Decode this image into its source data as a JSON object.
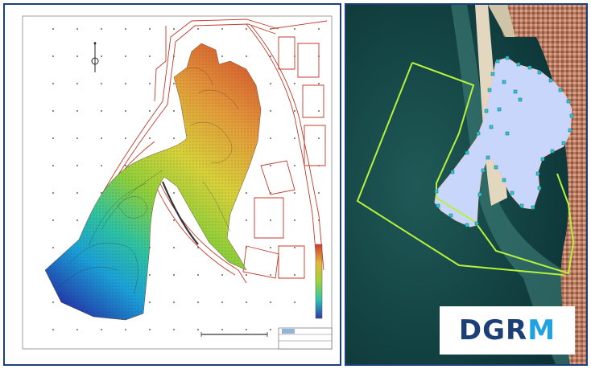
{
  "logo": {
    "text_main": "DGR",
    "text_accent": "M"
  },
  "colors": {
    "frame_border": "#1d3f77",
    "logo_blue": "#1d3f77",
    "logo_accent": "#1ea3e0",
    "boundary_line": "#b6f23b",
    "harbour_fill": "#c8d6fb",
    "survey_point": "#2fc7d6",
    "plan_lines": "#c0392b"
  },
  "panels": {
    "left": "bathymetric-survey-plan",
    "right": "satellite-view"
  }
}
